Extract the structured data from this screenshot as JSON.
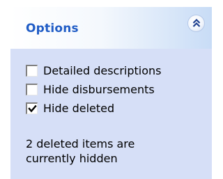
{
  "panel": {
    "title": "Options",
    "collapse_icon": "double-chevron-up-icon"
  },
  "options": [
    {
      "label": "Detailed descriptions",
      "checked": false
    },
    {
      "label": "Hide disbursements",
      "checked": false
    },
    {
      "label": "Hide deleted",
      "checked": true
    }
  ],
  "status": {
    "line1": "2 deleted items are",
    "line2": "currently hidden"
  },
  "colors": {
    "title": "#215dc6",
    "body_bg": "#d6dff7",
    "header_gradient_end": "#c8dcf6"
  }
}
